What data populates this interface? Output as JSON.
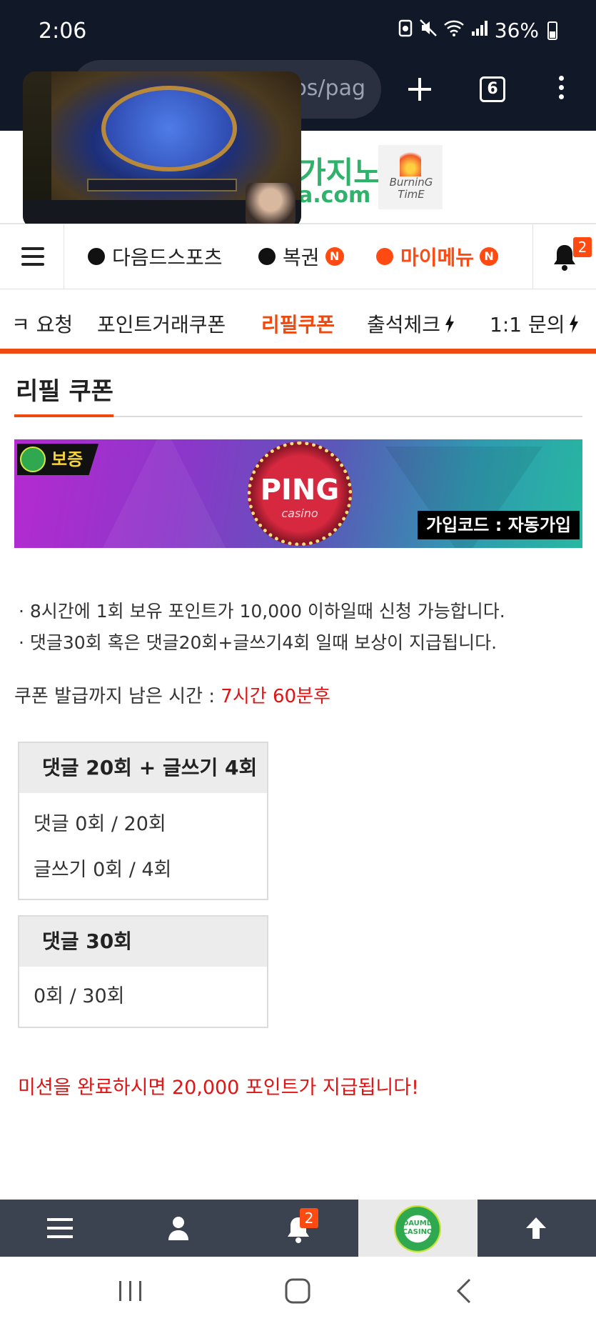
{
  "status_bar": {
    "time": "2:06",
    "battery": "36%"
  },
  "browser": {
    "url_fragment": "os/pag",
    "tab_count": "6"
  },
  "site_header": {
    "logo_line1": "가지노",
    "logo_line2": "a.com",
    "burning_logo_text": "BurninG TimE"
  },
  "main_nav": {
    "items": [
      {
        "label": "다음드스포츠",
        "has_new": false
      },
      {
        "label": "복권",
        "has_new": true
      },
      {
        "label": "마이메뉴",
        "has_new": true
      }
    ],
    "new_badge": "N",
    "notification_count": "2"
  },
  "sub_nav": {
    "items": [
      "ㅋ 요청",
      "포인트거래쿠폰",
      "리필쿠폰",
      "출석체크",
      "1:1 문의"
    ],
    "active": "리필쿠폰"
  },
  "page": {
    "title": "리필 쿠폰",
    "banner": {
      "badge": "보증",
      "brand": "PING",
      "brand_sub": "casino",
      "join_code": "가입코드 : 자동가입"
    },
    "info": [
      "· 8시간에 1회 보유 포인트가 10,000 이하일때 신청 가능합니다.",
      "· 댓글30회 혹은 댓글20회+글쓰기4회 일때 보상이 지급됩니다."
    ],
    "time_label": "쿠폰 발급까지 남은 시간 : ",
    "time_value": "7시간 60분후",
    "missions": [
      {
        "title": "댓글 20회 + 글쓰기 4회",
        "rows": [
          "댓글 0회 / 20회",
          "글쓰기 0회 / 4회"
        ]
      },
      {
        "title": "댓글 30회",
        "rows": [
          "0회 / 30회"
        ]
      }
    ],
    "complete_message": "미션을 완료하시면 20,000 포인트가 지급됩니다!"
  },
  "bottom_bar": {
    "notification_count": "2",
    "home_logo_text": "DAUMD CASINO"
  },
  "colors": {
    "accent": "#ee4a10",
    "alert_red": "#e01414",
    "bottom_bar": "#3b4250",
    "status_bar": "#111827"
  }
}
